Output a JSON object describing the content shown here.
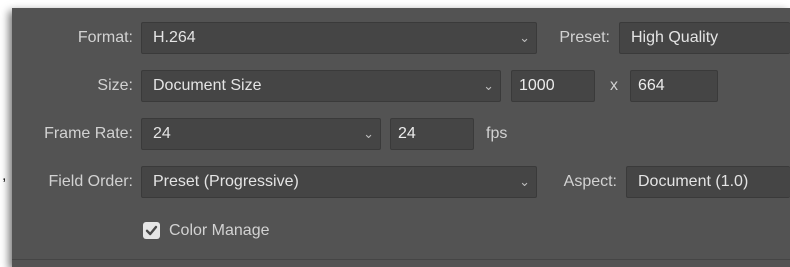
{
  "edge_mark": ",",
  "format": {
    "label": "Format:",
    "value": "H.264"
  },
  "preset": {
    "label": "Preset:",
    "value": "High Quality"
  },
  "size": {
    "label": "Size:",
    "value": "Document Size",
    "width": "1000",
    "separator": "x",
    "height": "664"
  },
  "frame_rate": {
    "label": "Frame Rate:",
    "value": "24",
    "custom_value": "24",
    "unit": "fps"
  },
  "field_order": {
    "label": "Field Order:",
    "value": "Preset (Progressive)"
  },
  "aspect": {
    "label": "Aspect:",
    "value": "Document (1.0)"
  },
  "color_manage": {
    "label": "Color Manage",
    "checked": true
  },
  "colors": {
    "panel_bg": "#535353",
    "control_bg": "#454545",
    "text": "#d6d6d6"
  },
  "icons": {
    "dropdown": "chevron-down-icon",
    "checkbox": "checkmark-icon"
  }
}
